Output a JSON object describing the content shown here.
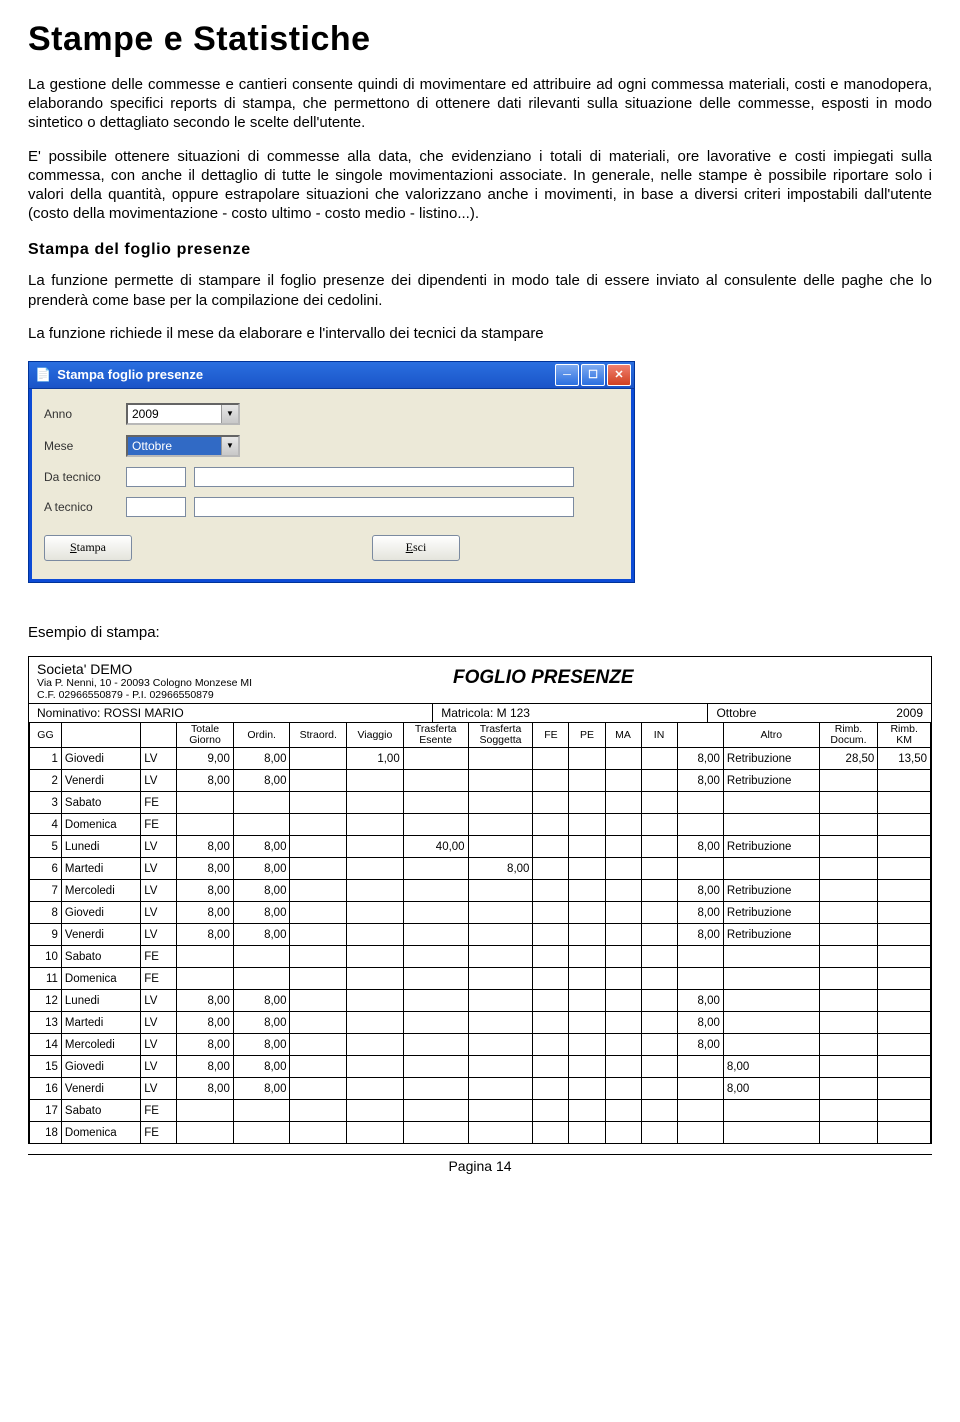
{
  "header_title": "Stampe e Statistiche",
  "para1": "La gestione delle commesse e cantieri consente quindi di movimentare ed attribuire ad ogni commessa materiali, costi e manodopera, elaborando specifici reports di stampa, che permettono di ottenere dati rilevanti sulla situazione delle commesse, esposti in modo sintetico o dettagliato secondo le scelte dell'utente.",
  "para2": "E' possibile ottenere situazioni di commesse alla data, che evidenziano i totali di materiali, ore lavorative e costi impiegati sulla commessa, con anche il dettaglio di tutte le singole movimentazioni associate. In generale, nelle stampe è possibile riportare solo i valori della quantità, oppure estrapolare situazioni che valorizzano anche i movimenti, in base a diversi criteri impostabili dall'utente (costo della movimentazione - costo ultimo - costo medio - listino...).",
  "section_title": "Stampa del foglio presenze",
  "para3": "La funzione permette di stampare il foglio presenze dei dipendenti in modo tale di essere inviato al consulente delle paghe che lo prenderà come base per la compilazione dei cedolini.",
  "para4": "La funzione richiede il mese da elaborare e l'intervallo dei tecnici da stampare",
  "dialog": {
    "title": "Stampa foglio presenze",
    "labels": {
      "anno": "Anno",
      "mese": "Mese",
      "da": "Da tecnico",
      "a": "A tecnico"
    },
    "anno_value": "2009",
    "mese_value": "Ottobre",
    "btn_stampa": "Stampa",
    "btn_esci": "Esci"
  },
  "example_label": "Esempio di stampa:",
  "report": {
    "society": "Societa' DEMO",
    "address": "Via P. Nenni, 10 - 20093 Cologno Monzese MI",
    "fisc": "C.F. 02966550879 - P.I. 02966550879",
    "title": "FOGLIO PRESENZE",
    "nominative_lbl": "Nominativo:",
    "nominative": "ROSSI MARIO",
    "matricola_lbl": "Matricola:",
    "matricola": "M 123",
    "period_month": "Ottobre",
    "period_year": "2009",
    "headers": [
      "GG",
      "",
      "",
      "Totale Giorno",
      "Ordin.",
      "Straord.",
      "Viaggio",
      "Trasferta Esente",
      "Trasferta Soggetta",
      "FE",
      "PE",
      "MA",
      "IN",
      "",
      "Altro",
      "Rimb. Docum.",
      "Rimb. KM"
    ],
    "rows": [
      {
        "n": "1",
        "d": "Giovedi",
        "c": "LV",
        "tg": "9,00",
        "ord": "8,00",
        "str": "",
        "via": "1,00",
        "te": "",
        "ts": "",
        "fe": "",
        "pe": "",
        "ma": "",
        "in": "",
        "av": "8,00",
        "al": "Retribuzione",
        "rd": "28,50",
        "rk": "13,50"
      },
      {
        "n": "2",
        "d": "Venerdi",
        "c": "LV",
        "tg": "8,00",
        "ord": "8,00",
        "str": "",
        "via": "",
        "te": "",
        "ts": "",
        "fe": "",
        "pe": "",
        "ma": "",
        "in": "",
        "av": "8,00",
        "al": "Retribuzione",
        "rd": "",
        "rk": ""
      },
      {
        "n": "3",
        "d": "Sabato",
        "c": "FE",
        "tg": "",
        "ord": "",
        "str": "",
        "via": "",
        "te": "",
        "ts": "",
        "fe": "",
        "pe": "",
        "ma": "",
        "in": "",
        "av": "",
        "al": "",
        "rd": "",
        "rk": ""
      },
      {
        "n": "4",
        "d": "Domenica",
        "c": "FE",
        "tg": "",
        "ord": "",
        "str": "",
        "via": "",
        "te": "",
        "ts": "",
        "fe": "",
        "pe": "",
        "ma": "",
        "in": "",
        "av": "",
        "al": "",
        "rd": "",
        "rk": ""
      },
      {
        "n": "5",
        "d": "Lunedi",
        "c": "LV",
        "tg": "8,00",
        "ord": "8,00",
        "str": "",
        "via": "",
        "te": "40,00",
        "ts": "",
        "fe": "",
        "pe": "",
        "ma": "",
        "in": "",
        "av": "8,00",
        "al": "Retribuzione",
        "rd": "",
        "rk": ""
      },
      {
        "n": "6",
        "d": "Martedi",
        "c": "LV",
        "tg": "8,00",
        "ord": "8,00",
        "str": "",
        "via": "",
        "te": "",
        "ts": "8,00",
        "fe": "",
        "pe": "",
        "ma": "",
        "in": "",
        "av": "",
        "al": "",
        "rd": "",
        "rk": ""
      },
      {
        "n": "7",
        "d": "Mercoledi",
        "c": "LV",
        "tg": "8,00",
        "ord": "8,00",
        "str": "",
        "via": "",
        "te": "",
        "ts": "",
        "fe": "",
        "pe": "",
        "ma": "",
        "in": "",
        "av": "8,00",
        "al": "Retribuzione",
        "rd": "",
        "rk": ""
      },
      {
        "n": "8",
        "d": "Giovedi",
        "c": "LV",
        "tg": "8,00",
        "ord": "8,00",
        "str": "",
        "via": "",
        "te": "",
        "ts": "",
        "fe": "",
        "pe": "",
        "ma": "",
        "in": "",
        "av": "8,00",
        "al": "Retribuzione",
        "rd": "",
        "rk": ""
      },
      {
        "n": "9",
        "d": "Venerdi",
        "c": "LV",
        "tg": "8,00",
        "ord": "8,00",
        "str": "",
        "via": "",
        "te": "",
        "ts": "",
        "fe": "",
        "pe": "",
        "ma": "",
        "in": "",
        "av": "8,00",
        "al": "Retribuzione",
        "rd": "",
        "rk": ""
      },
      {
        "n": "10",
        "d": "Sabato",
        "c": "FE",
        "tg": "",
        "ord": "",
        "str": "",
        "via": "",
        "te": "",
        "ts": "",
        "fe": "",
        "pe": "",
        "ma": "",
        "in": "",
        "av": "",
        "al": "",
        "rd": "",
        "rk": ""
      },
      {
        "n": "11",
        "d": "Domenica",
        "c": "FE",
        "tg": "",
        "ord": "",
        "str": "",
        "via": "",
        "te": "",
        "ts": "",
        "fe": "",
        "pe": "",
        "ma": "",
        "in": "",
        "av": "",
        "al": "",
        "rd": "",
        "rk": ""
      },
      {
        "n": "12",
        "d": "Lunedi",
        "c": "LV",
        "tg": "8,00",
        "ord": "8,00",
        "str": "",
        "via": "",
        "te": "",
        "ts": "",
        "fe": "",
        "pe": "",
        "ma": "",
        "in": "",
        "av": "8,00",
        "al": "",
        "rd": "",
        "rk": ""
      },
      {
        "n": "13",
        "d": "Martedi",
        "c": "LV",
        "tg": "8,00",
        "ord": "8,00",
        "str": "",
        "via": "",
        "te": "",
        "ts": "",
        "fe": "",
        "pe": "",
        "ma": "",
        "in": "",
        "av": "8,00",
        "al": "",
        "rd": "",
        "rk": ""
      },
      {
        "n": "14",
        "d": "Mercoledi",
        "c": "LV",
        "tg": "8,00",
        "ord": "8,00",
        "str": "",
        "via": "",
        "te": "",
        "ts": "",
        "fe": "",
        "pe": "",
        "ma": "",
        "in": "",
        "av": "8,00",
        "al": "",
        "rd": "",
        "rk": ""
      },
      {
        "n": "15",
        "d": "Giovedi",
        "c": "LV",
        "tg": "8,00",
        "ord": "8,00",
        "str": "",
        "via": "",
        "te": "",
        "ts": "",
        "fe": "",
        "pe": "",
        "ma": "",
        "in": "",
        "av": "",
        "al": "8,00",
        "rd": "",
        "rk": ""
      },
      {
        "n": "16",
        "d": "Venerdi",
        "c": "LV",
        "tg": "8,00",
        "ord": "8,00",
        "str": "",
        "via": "",
        "te": "",
        "ts": "",
        "fe": "",
        "pe": "",
        "ma": "",
        "in": "",
        "av": "",
        "al": "8,00",
        "rd": "",
        "rk": ""
      },
      {
        "n": "17",
        "d": "Sabato",
        "c": "FE",
        "tg": "",
        "ord": "",
        "str": "",
        "via": "",
        "te": "",
        "ts": "",
        "fe": "",
        "pe": "",
        "ma": "",
        "in": "",
        "av": "",
        "al": "",
        "rd": "",
        "rk": ""
      },
      {
        "n": "18",
        "d": "Domenica",
        "c": "FE",
        "tg": "",
        "ord": "",
        "str": "",
        "via": "",
        "te": "",
        "ts": "",
        "fe": "",
        "pe": "",
        "ma": "",
        "in": "",
        "av": "",
        "al": "",
        "rd": "",
        "rk": ""
      }
    ]
  },
  "footer": "Pagina 14"
}
